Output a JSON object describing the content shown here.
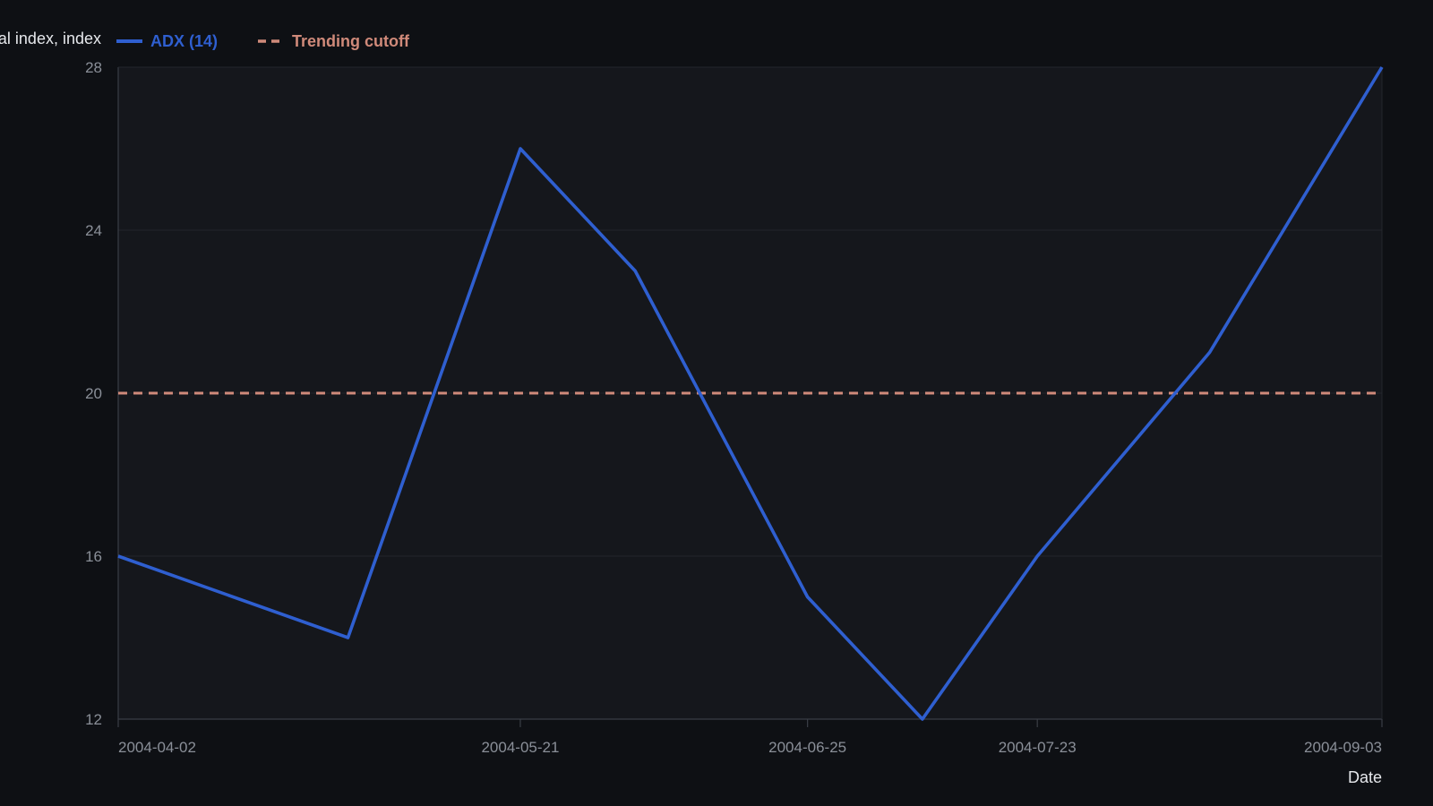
{
  "colors": {
    "background": "#0e1014",
    "plot_background": "#15171c",
    "grid": "#23262d",
    "axis": "#3a3e46",
    "tick_label": "#8a8f98",
    "label": "#e6e8ec",
    "adx": "#2f5fd0",
    "cutoff": "#d08a7a"
  },
  "chart_data": {
    "type": "line",
    "xlabel": "Date",
    "ylabel": "Average directional index, index",
    "ylim": [
      12,
      28
    ],
    "yticks": [
      12,
      16,
      20,
      24,
      28
    ],
    "xlim": [
      "2004-04-02",
      "2004-09-03"
    ],
    "xticks": [
      "2004-04-02",
      "2004-05-21",
      "2004-06-25",
      "2004-07-23",
      "2004-09-03"
    ],
    "grid": true,
    "legend": "top-left",
    "series": [
      {
        "name": "ADX (14)",
        "style": "solid",
        "color": "#2f5fd0",
        "x": [
          "2004-04-02",
          "2004-04-30",
          "2004-05-21",
          "2004-06-04",
          "2004-06-25",
          "2004-07-09",
          "2004-07-23",
          "2004-08-13",
          "2004-09-03"
        ],
        "y": [
          16,
          14,
          26,
          23,
          15,
          12,
          16,
          21,
          28
        ]
      },
      {
        "name": "Trending cutoff",
        "style": "dashed",
        "color": "#d08a7a",
        "x": [
          "2004-04-02",
          "2004-09-03"
        ],
        "y": [
          20,
          20
        ]
      }
    ]
  }
}
